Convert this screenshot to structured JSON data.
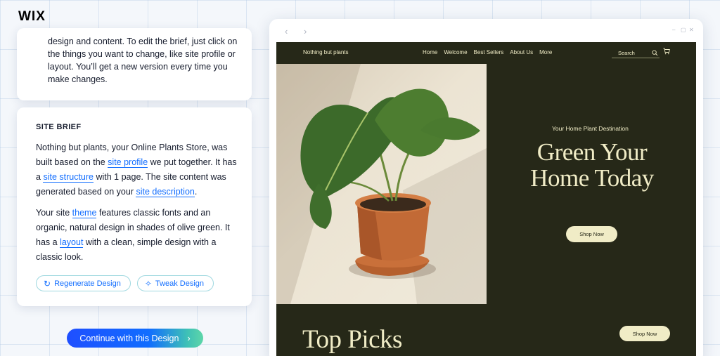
{
  "brand": {
    "logo": "WIX"
  },
  "intro_card": {
    "text": "design and content. To edit the brief, just click on the things you want to change, like site profile or layout. You’ll get a new version every time you make changes."
  },
  "site_brief": {
    "title": "SITE BRIEF",
    "p1": {
      "t1": "Nothing but plants, your Online Plants Store, was built based on the ",
      "link1": "site profile",
      "t2": " we put together. It has a ",
      "link2": "site structure",
      "t3": " with 1 page. The site content was generated based on your ",
      "link3": "site description",
      "t4": "."
    },
    "p2": {
      "t1": "Your site ",
      "link1": "theme",
      "t2": " features classic fonts and an organic, natural design in shades of olive green. It has a ",
      "link2": "layout",
      "t3": " with a clean, simple design with a classic look."
    },
    "regenerate_label": "Regenerate Design",
    "tweak_label": "Tweak Design"
  },
  "cta": {
    "label": "Continue with this Design",
    "arrow": "›"
  },
  "browser": {
    "back": "‹",
    "forward": "›",
    "window_controls": [
      "–",
      "▢",
      "✕"
    ]
  },
  "site_preview": {
    "brand": "Nothing but plants",
    "nav": [
      "Home",
      "Welcome",
      "Best Sellers",
      "About Us",
      "More"
    ],
    "search_placeholder": "Search",
    "hero_tagline": "Your Home Plant Destination",
    "hero_title_line1": "Green Your",
    "hero_title_line2": "Home Today",
    "shop_now": "Shop Now",
    "section_title": "Top Picks",
    "shop_now_2": "Shop Now"
  },
  "colors": {
    "accent": "#116dff",
    "site_background": "#262818",
    "site_text": "#f0ecc6"
  },
  "icons": {
    "regenerate": "refresh-icon",
    "tweak": "magic-wand-icon",
    "search": "search-icon",
    "cart": "cart-icon"
  }
}
